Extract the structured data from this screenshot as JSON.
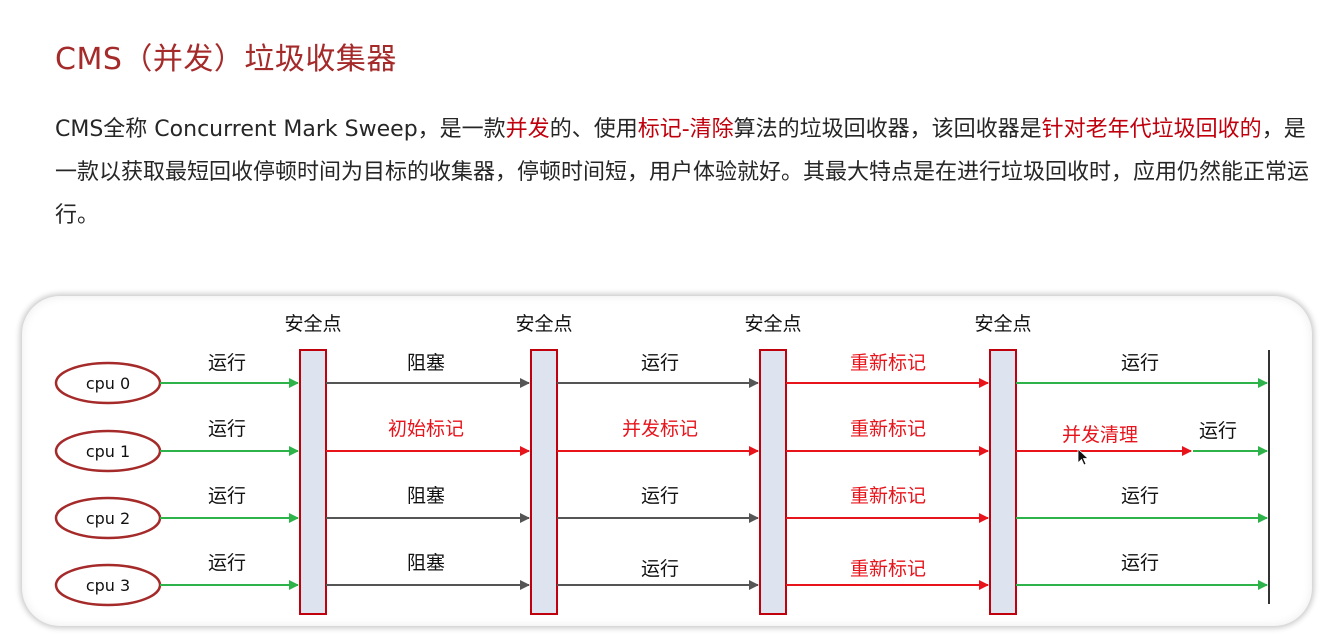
{
  "title": "CMS（并发）垃圾收集器",
  "description": {
    "segments": [
      {
        "text": "CMS全称 Concurrent Mark Sweep，是一款",
        "highlight": false
      },
      {
        "text": "并发",
        "highlight": true
      },
      {
        "text": "的、使用",
        "highlight": false
      },
      {
        "text": "标记-清除",
        "highlight": true
      },
      {
        "text": "算法的垃圾回收器，该回收器是",
        "highlight": false
      },
      {
        "text": "针对老年代垃圾回收的",
        "highlight": true
      },
      {
        "text": "，是一款以获取最短回收停顿时间为目标的收集器，停顿时间短，用户体验就好。其最大特点是在进行垃圾回收时，应用仍然能正常运行。",
        "highlight": false
      }
    ]
  },
  "colors": {
    "title": "#a52a2a",
    "highlight": "#c0000c",
    "run": "#2db34a",
    "red": "#e8141c",
    "block": "#555555",
    "bar_fill": "#dde4f0",
    "bar_stroke": "#c0000c",
    "cpu_stroke": "#a52a2a"
  },
  "diagram": {
    "safepoints": [
      "安全点",
      "安全点",
      "安全点",
      "安全点"
    ],
    "cpus": [
      {
        "label": "cpu 0",
        "segments": [
          {
            "label": "运行",
            "kind": "run"
          },
          {
            "label": "阻塞",
            "kind": "block"
          },
          {
            "label": "运行",
            "kind": "block"
          },
          {
            "label": "重新标记",
            "kind": "red"
          },
          {
            "label": "运行",
            "kind": "run"
          }
        ]
      },
      {
        "label": "cpu 1",
        "segments": [
          {
            "label": "运行",
            "kind": "run"
          },
          {
            "label": "初始标记",
            "kind": "red"
          },
          {
            "label": "并发标记",
            "kind": "red"
          },
          {
            "label": "重新标记",
            "kind": "red"
          },
          {
            "label": "并发清理",
            "kind": "red",
            "then": {
              "label": "运行",
              "kind": "run"
            }
          }
        ]
      },
      {
        "label": "cpu 2",
        "segments": [
          {
            "label": "运行",
            "kind": "run"
          },
          {
            "label": "阻塞",
            "kind": "block"
          },
          {
            "label": "运行",
            "kind": "block"
          },
          {
            "label": "重新标记",
            "kind": "red"
          },
          {
            "label": "运行",
            "kind": "run"
          }
        ]
      },
      {
        "label": "cpu 3",
        "segments": [
          {
            "label": "运行",
            "kind": "run"
          },
          {
            "label": "阻塞",
            "kind": "block"
          },
          {
            "label": "运行",
            "kind": "block"
          },
          {
            "label": "重新标记",
            "kind": "red"
          },
          {
            "label": "运行",
            "kind": "run"
          }
        ]
      }
    ]
  }
}
